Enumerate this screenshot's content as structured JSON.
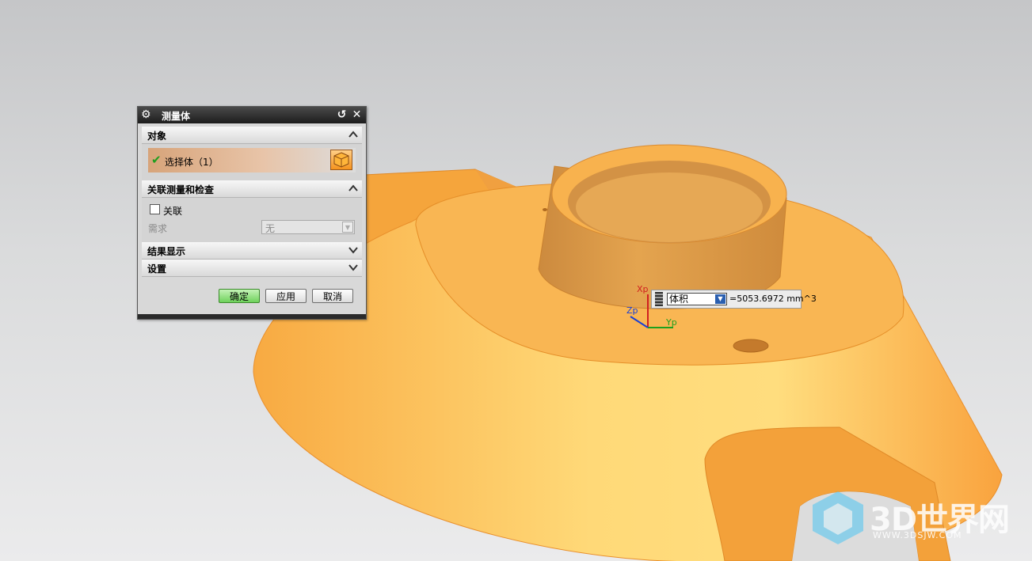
{
  "dialog": {
    "title": "测量体",
    "sections": {
      "objects": {
        "label": "对象",
        "select_label": "选择体（1）"
      },
      "assoc": {
        "label": "关联测量和检查",
        "checkbox_label": "关联",
        "requirement_label": "需求",
        "requirement_value": "无"
      },
      "results": {
        "label": "结果显示"
      },
      "settings": {
        "label": "设置"
      }
    },
    "buttons": {
      "ok": "确定",
      "apply": "应用",
      "cancel": "取消"
    }
  },
  "measure": {
    "type": "体积",
    "value": "=5053.6972 mm^3"
  },
  "axes": {
    "x": "Xp",
    "y": "Yp",
    "z": "Zp"
  },
  "watermark": {
    "brand": "3D世界网",
    "url": "WWW.3DSJW.COM"
  },
  "colors": {
    "model": "#f7a83a",
    "title_bar": "#2a2a2a",
    "ok_button": "#6fd25c"
  }
}
